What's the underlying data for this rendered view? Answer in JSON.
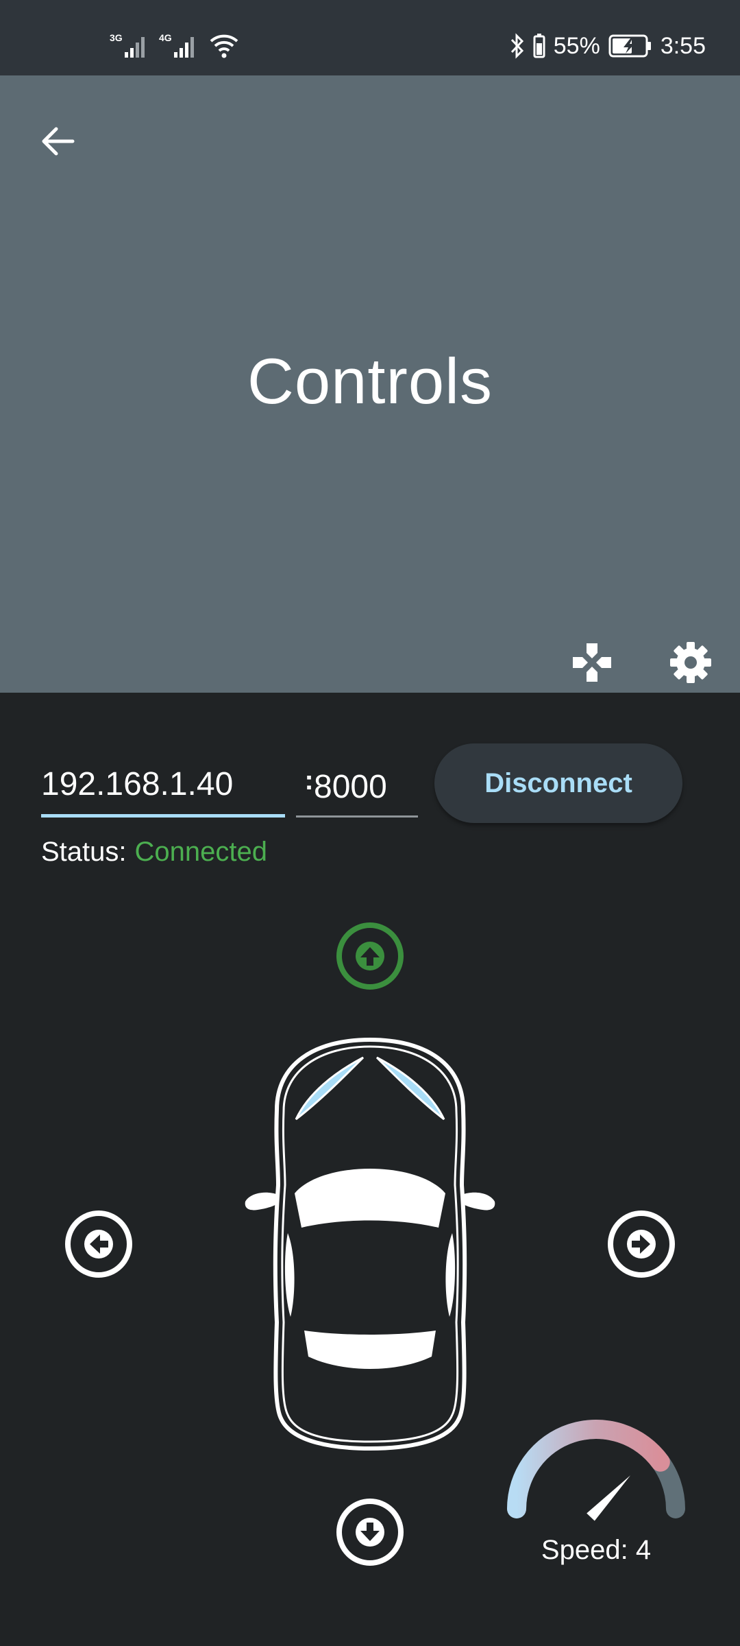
{
  "status_bar": {
    "net1": "3G",
    "net2": "4G",
    "battery_pct": "55%",
    "time": "3:55"
  },
  "app_bar": {
    "title": "Controls",
    "back_icon": "arrow-back-icon",
    "actions": [
      "gamepad-icon",
      "settings-icon"
    ]
  },
  "connection": {
    "ip": "192.168.1.40",
    "separator": ":",
    "port": "8000",
    "button_label": "Disconnect",
    "status_label": "Status:",
    "status_value": "Connected"
  },
  "controls": {
    "up_icon": "arrow-up-circle-icon",
    "down_icon": "arrow-down-circle-icon",
    "left_icon": "arrow-left-circle-icon",
    "right_icon": "arrow-right-circle-icon",
    "active_direction": "up"
  },
  "speed": {
    "label": "Speed: 4",
    "value": 4,
    "max": 5
  },
  "colors": {
    "accent": "#a9ddf7",
    "connected": "#4caf50",
    "active_arrow": "#3b8f3e",
    "app_bar": "#5d6b73",
    "background": "#202325"
  }
}
